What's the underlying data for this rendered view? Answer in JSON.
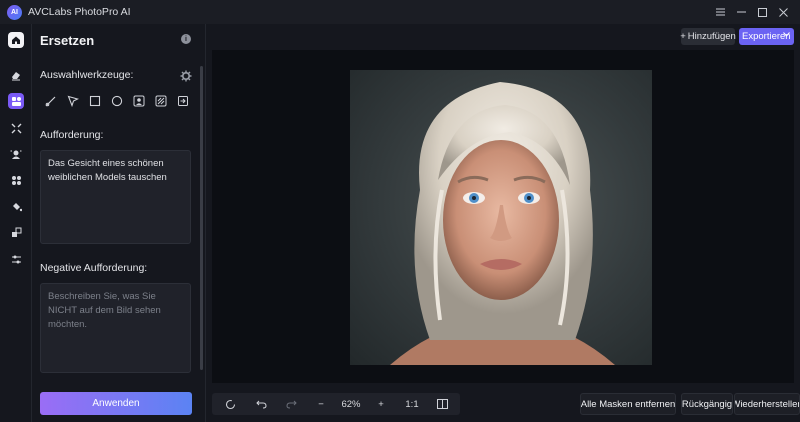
{
  "window": {
    "title": "AVCLabs PhotoPro AI",
    "logo_text": "AI",
    "controls": [
      "menu-icon",
      "minimize-icon",
      "maximize-icon",
      "close-icon"
    ]
  },
  "sidebar": {
    "items": [
      "home-icon",
      "eraser-icon",
      "replace-icon",
      "expand-icon",
      "portrait-icon",
      "object-icon",
      "fill-icon",
      "upscale-icon",
      "adjust-icon"
    ],
    "active": "replace-icon"
  },
  "panel": {
    "title": "Ersetzen",
    "info_icon_text": "i",
    "selection_tools_label": "Auswahlwerkzeuge:",
    "tools": [
      "brush-icon",
      "lasso-icon",
      "rectangle-select-icon",
      "ellipse-select-icon",
      "person-select-icon",
      "background-select-icon",
      "import-mask-icon"
    ],
    "prompt_label": "Aufforderung:",
    "prompt_value": "Das Gesicht eines schönen weiblichen Models tauschen",
    "negative_label": "Negative Aufforderung:",
    "negative_placeholder": "Beschreiben Sie, was Sie NICHT auf dem Bild sehen möchten.",
    "apply_label": "Anwenden"
  },
  "header": {
    "add_label": "Hinzufügen",
    "add_icon": "+",
    "export_label": "Exportieren",
    "export_caret": "⌄"
  },
  "bottom_toolbar": {
    "zoom": "62%",
    "ratio": "1:1",
    "icons": [
      "reset-icon",
      "undo-icon",
      "redo-icon",
      "zoom-out-icon",
      "zoom-in-icon",
      "compare-icon"
    ],
    "zoom_out": "−",
    "zoom_in": "+"
  },
  "actions": {
    "remove_masks": "Alle Masken entfernen",
    "undo": "Rückgängig",
    "redo": "Wiederherstellen"
  },
  "colors": {
    "accent": "#7a5af5",
    "export": "#6b63f3",
    "background": "#15171e"
  }
}
